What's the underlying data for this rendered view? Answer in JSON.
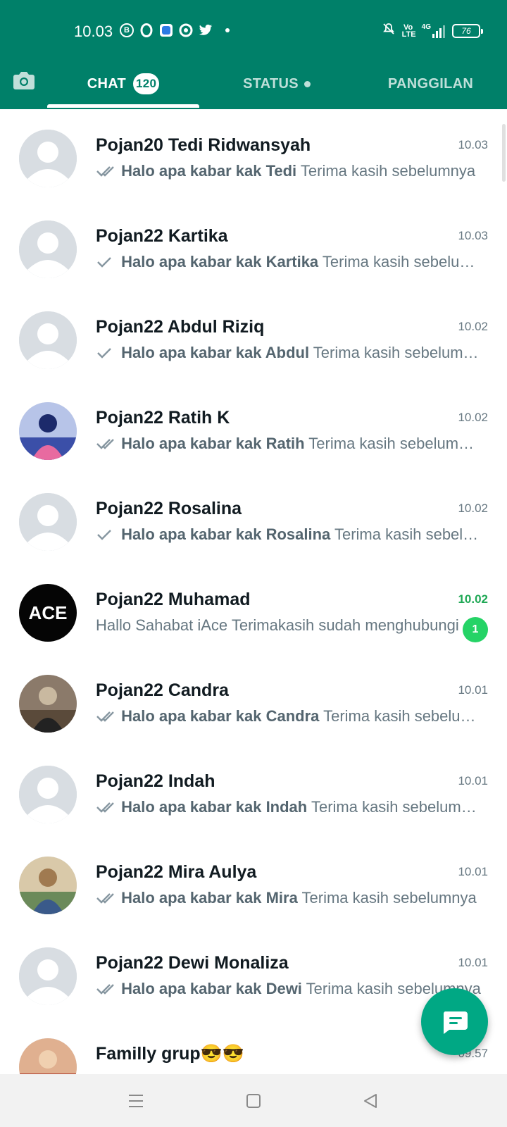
{
  "status_bar": {
    "time": "10.03",
    "app_icons": [
      "b-icon",
      "o-icon",
      "blue-app-icon",
      "chrome-like-icon",
      "twitter-icon"
    ],
    "app_glyphs": [
      "B",
      "O",
      "",
      "",
      ""
    ],
    "network_label": "4G",
    "volte_label": "Vo LTE",
    "battery": "76"
  },
  "tabs": [
    {
      "label": "CHAT",
      "badge": "120",
      "active": true
    },
    {
      "label": "STATUS",
      "has_dot": true
    },
    {
      "label": "PANGGILAN"
    }
  ],
  "colors": {
    "header": "#008069",
    "accent": "#00a884",
    "unread": "#25d366",
    "tick_read": "#8696a0"
  },
  "chats": [
    {
      "name": "Pojan20 Tedi Ridwansyah",
      "time": "10.03",
      "tick": "double",
      "bold": "Halo apa kabar kak Tedi",
      "rest": "Terima kasih sebelumnya",
      "avatar": "default"
    },
    {
      "name": "Pojan22 Kartika",
      "time": "10.03",
      "tick": "single",
      "bold": "Halo apa kabar kak Kartika",
      "rest": "Terima kasih sebelumnya",
      "avatar": "default"
    },
    {
      "name": "Pojan22 Abdul Riziq",
      "time": "10.02",
      "tick": "single",
      "bold": "Halo apa kabar kak Abdul",
      "rest": "Terima kasih sebelumnya",
      "avatar": "default"
    },
    {
      "name": "Pojan22 Ratih K",
      "time": "10.02",
      "tick": "double",
      "bold": "Halo apa kabar kak Ratih",
      "rest": "Terima kasih sebelumnya",
      "avatar": "photo-ratih"
    },
    {
      "name": "Pojan22 Rosalina",
      "time": "10.02",
      "tick": "single",
      "bold": "Halo apa kabar kak Rosalina",
      "rest": "Terima kasih sebelumnya",
      "avatar": "default"
    },
    {
      "name": "Pojan22 Muhamad",
      "time": "10.02",
      "tick": "none",
      "bold": "",
      "rest": "Hallo Sahabat iAce  Terimakasih sudah menghubungi",
      "unread": "1",
      "avatar": "logo-ace",
      "avatar_text": "ACE"
    },
    {
      "name": "Pojan22 Candra",
      "time": "10.01",
      "tick": "double",
      "bold": "Halo apa kabar kak Candra",
      "rest": "Terima kasih sebelumnya",
      "avatar": "photo-candra"
    },
    {
      "name": "Pojan22 Indah",
      "time": "10.01",
      "tick": "double",
      "bold": "Halo apa kabar kak Indah",
      "rest": "Terima kasih sebelumnya",
      "avatar": "default"
    },
    {
      "name": "Pojan22 Mira Aulya",
      "time": "10.01",
      "tick": "double",
      "bold": "Halo apa kabar kak Mira",
      "rest": "Terima kasih sebelumnya",
      "avatar": "photo-mira"
    },
    {
      "name": "Pojan22 Dewi Monaliza",
      "time": "10.01",
      "tick": "double",
      "bold": "Halo apa kabar kak Dewi",
      "rest": "Terima kasih sebelumnya",
      "avatar": "default"
    },
    {
      "name": "Familly grup😎😎",
      "time": "09.57",
      "tick": "none",
      "bold": "",
      "rest": "",
      "unread": "",
      "avatar": "photo-family"
    }
  ],
  "fab": {
    "icon": "new-chat-icon"
  },
  "navbar": {
    "icons": [
      "menu-icon",
      "home-icon",
      "back-icon"
    ]
  }
}
